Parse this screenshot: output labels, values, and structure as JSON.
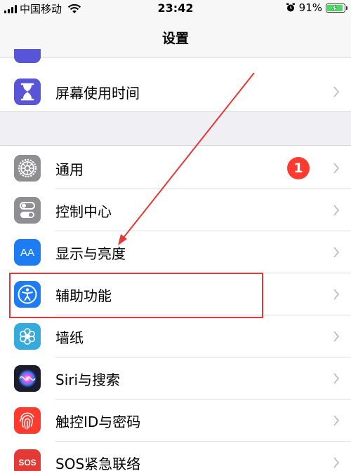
{
  "status_bar": {
    "carrier": "中国移动",
    "time": "23:42",
    "battery_percent": "91%",
    "battery_level": 0.91,
    "charging": true
  },
  "nav": {
    "title": "设置"
  },
  "settings": {
    "screen_time": {
      "label": "屏幕使用时间",
      "icon": "hourglass-icon",
      "color": "#5856d6"
    },
    "general": {
      "label": "通用",
      "icon": "gear-icon",
      "color": "#8e8e93",
      "badge": "1"
    },
    "control_center": {
      "label": "控制中心",
      "icon": "toggles-icon",
      "color": "#8e8e93"
    },
    "display": {
      "label": "显示与亮度",
      "icon": "display-aa-icon",
      "icon_text": "AA",
      "color": "#1e7cf2"
    },
    "accessibility": {
      "label": "辅助功能",
      "icon": "accessibility-icon",
      "color": "#1e7cf2"
    },
    "wallpaper": {
      "label": "墙纸",
      "icon": "flower-icon",
      "color": "#35aadc"
    },
    "siri": {
      "label": "Siri与搜索",
      "icon": "siri-icon",
      "color": "#1c1c2e"
    },
    "touch_id": {
      "label": "触控ID与密码",
      "icon": "fingerprint-icon",
      "color": "#ff3b30"
    },
    "sos": {
      "label": "SOS紧急联络",
      "icon": "sos-icon",
      "icon_text": "SOS",
      "color": "#e53935"
    }
  },
  "colors": {
    "annotation_red": "#e53935",
    "badge_red": "#ff3b30",
    "background": "#efeff4"
  }
}
